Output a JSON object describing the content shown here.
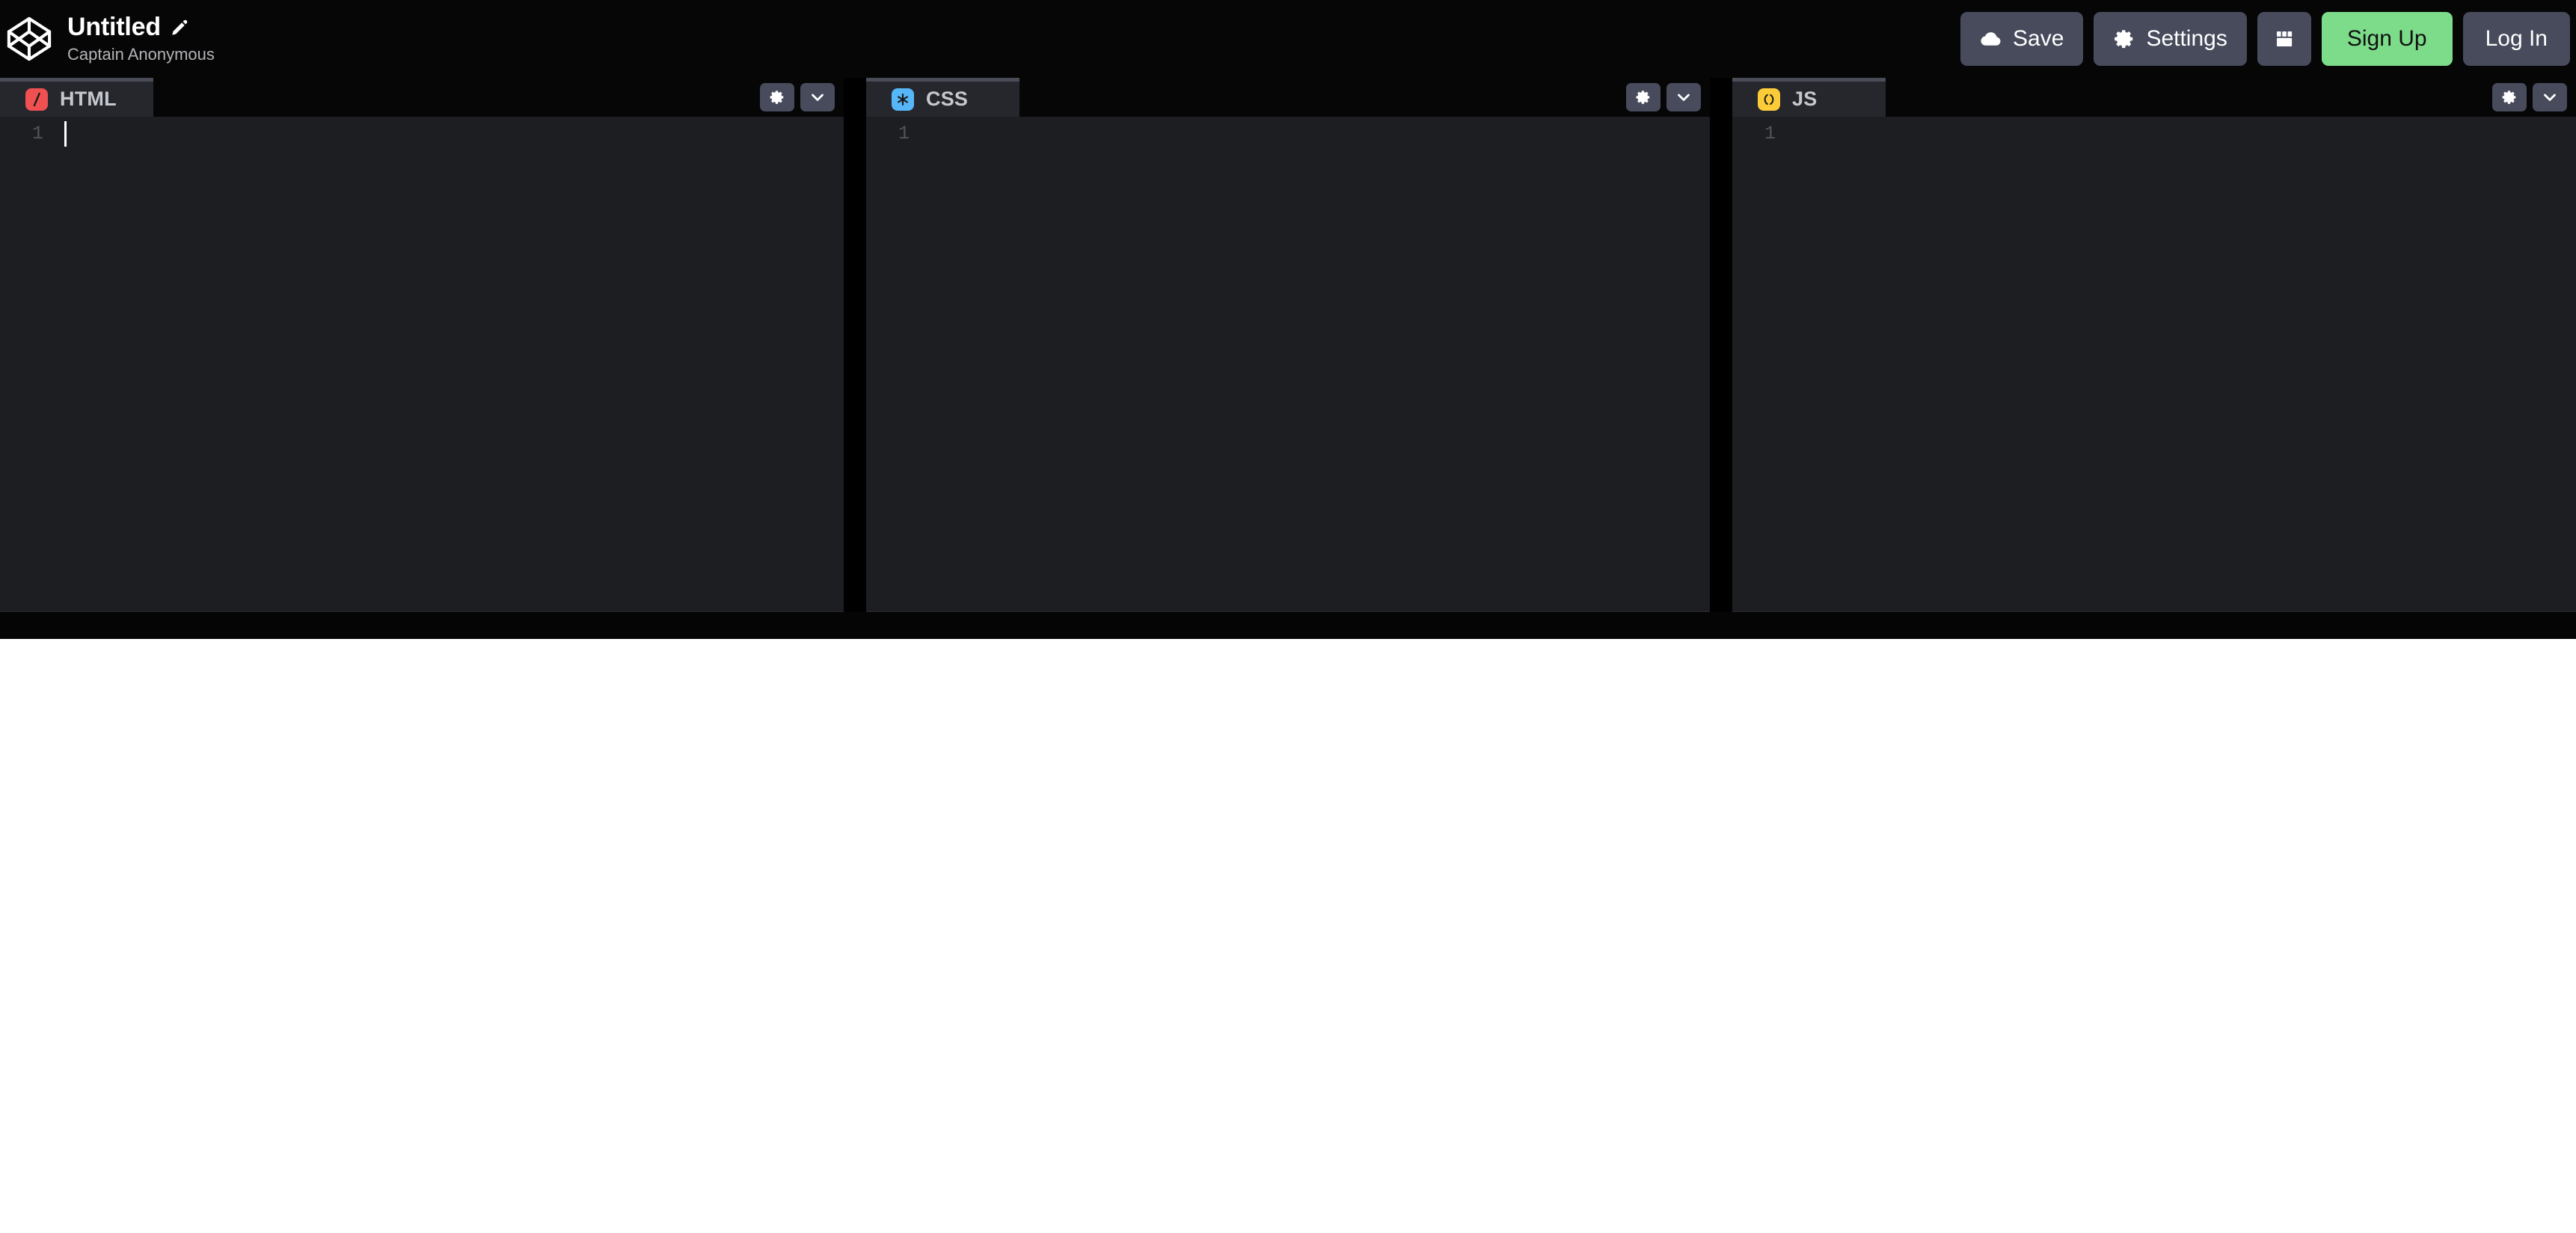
{
  "app": {
    "name": "CodePen",
    "logo_icon": "codepen-logo-icon",
    "background": "#060606"
  },
  "header": {
    "pen_title": "Untitled",
    "edit_icon": "pencil-edit-icon",
    "author": "Captain Anonymous",
    "actions": [
      {
        "id": "save",
        "label": "Save",
        "icon": "cloud-save-icon",
        "style": "default"
      },
      {
        "id": "settings",
        "label": "Settings",
        "icon": "gear-icon",
        "style": "default"
      },
      {
        "id": "layout",
        "label": "",
        "icon": "change-view-layout-icon",
        "style": "icon-only"
      },
      {
        "id": "signup",
        "label": "Sign Up",
        "icon": "",
        "style": "primary"
      },
      {
        "id": "login",
        "label": "Log In",
        "icon": "",
        "style": "default"
      }
    ]
  },
  "colors": {
    "accent_green": "#7cdc8a",
    "button_gray": "#474b5c",
    "editor_bg": "#1d1e22",
    "page_bg": "#060606",
    "html_badge": "#f05050",
    "css_badge": "#56b6f7",
    "js_badge": "#fbcb38",
    "linenumber": "#54565c"
  },
  "editors": [
    {
      "id": "html",
      "label": "HTML",
      "badge_icon": "html-slash-icon",
      "badge_color": "#f05050",
      "active": true,
      "focused": true,
      "line_numbers": [
        "1"
      ],
      "lines": [
        ""
      ],
      "settings_icon": "gear-icon",
      "collapse_icon": "chevron-down-icon"
    },
    {
      "id": "css",
      "label": "CSS",
      "badge_icon": "css-asterisk-icon",
      "badge_color": "#56b6f7",
      "active": true,
      "focused": false,
      "line_numbers": [
        "1"
      ],
      "lines": [
        ""
      ],
      "settings_icon": "gear-icon",
      "collapse_icon": "chevron-down-icon"
    },
    {
      "id": "js",
      "label": "JS",
      "badge_icon": "js-parens-icon",
      "badge_color": "#fbcb38",
      "active": true,
      "focused": false,
      "line_numbers": [
        "1"
      ],
      "lines": [
        ""
      ],
      "settings_icon": "gear-icon",
      "collapse_icon": "chevron-down-icon"
    }
  ],
  "preview": {
    "content": "",
    "background": "#ffffff"
  }
}
